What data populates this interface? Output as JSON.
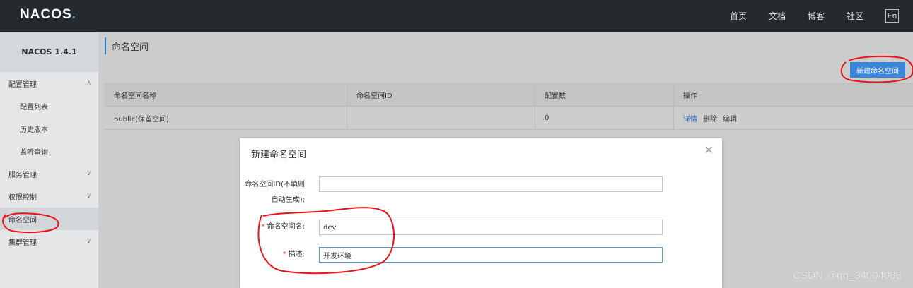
{
  "header": {
    "logo_text": "NACOS",
    "logo_dot": ".",
    "nav": [
      "首页",
      "文档",
      "博客",
      "社区"
    ],
    "lang": "En"
  },
  "sidebar": {
    "version": "NACOS 1.4.1",
    "items": [
      {
        "label": "配置管理",
        "type": "group",
        "chevron": "up"
      },
      {
        "label": "配置列表",
        "type": "child"
      },
      {
        "label": "历史版本",
        "type": "child"
      },
      {
        "label": "监听查询",
        "type": "child"
      },
      {
        "label": "服务管理",
        "type": "group",
        "chevron": "down"
      },
      {
        "label": "权限控制",
        "type": "group",
        "chevron": "down"
      },
      {
        "label": "命名空间",
        "type": "group",
        "active": true
      },
      {
        "label": "集群管理",
        "type": "group",
        "chevron": "down"
      }
    ]
  },
  "main": {
    "title": "命名空间",
    "create_button": "新建命名空间",
    "table": {
      "columns": [
        "命名空间名称",
        "命名空间ID",
        "配置数",
        "操作"
      ],
      "rows": [
        {
          "name": "public(保留空间)",
          "id": "",
          "count": "0",
          "actions": [
            "详情",
            "删除",
            "编辑"
          ]
        }
      ]
    }
  },
  "dialog": {
    "title": "新建命名空间",
    "fields": [
      {
        "label_line1": "命名空间ID(不填则",
        "label_line2": "自动生成):",
        "value": "",
        "required": false
      },
      {
        "label": "命名空间名:",
        "value": "dev",
        "required": true
      },
      {
        "label": "描述:",
        "value": "开发环境",
        "required": true
      }
    ]
  },
  "watermark": "CSDN @qq_34004088",
  "colors": {
    "header_bg": "#252a2f",
    "primary": "#3a85d8",
    "annotation": "#e8141c"
  }
}
